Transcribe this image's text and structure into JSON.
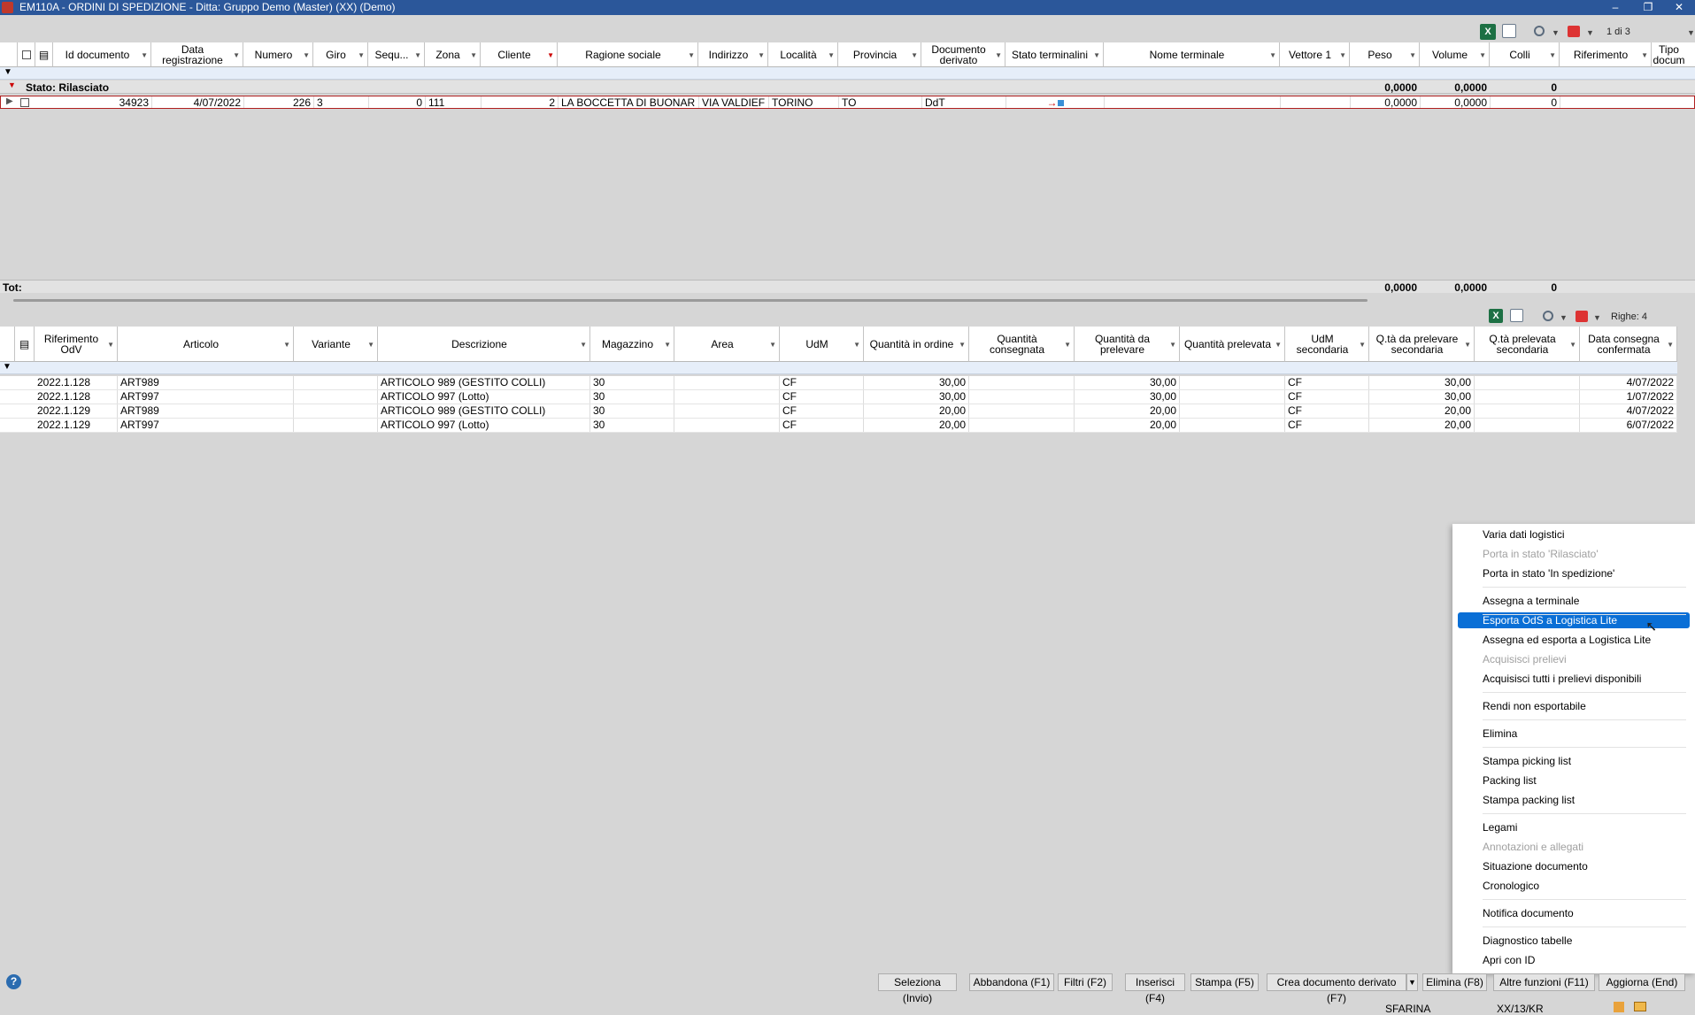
{
  "window": {
    "title": "EM110A - ORDINI DI SPEDIZIONE - Ditta: Gruppo Demo (Master) (XX)  (Demo)"
  },
  "top_toolbar": {
    "pager": "1 di 3"
  },
  "top_grid": {
    "columns": [
      "Id documento",
      "Data registrazione",
      "Numero",
      "Giro",
      "Sequ...",
      "Zona",
      "Cliente",
      "Ragione sociale",
      "Indirizzo",
      "Località",
      "Provincia",
      "Documento derivato",
      "Stato terminalini",
      "Nome terminale",
      "Vettore 1",
      "Peso",
      "Volume",
      "Colli",
      "Riferimento",
      "Tipo docum"
    ],
    "group": {
      "label": "Stato:  Rilasciato",
      "peso": "0,0000",
      "volume": "0,0000",
      "colli": "0"
    },
    "row": {
      "id": "34923",
      "data": "4/07/2022",
      "numero": "226",
      "giro": "3",
      "seq": "0",
      "zona": "111",
      "cliente": "2",
      "ragione": "LA BOCCETTA DI BUONAR",
      "indirizzo": "VIA VALDIEF",
      "localita": "TORINO",
      "provincia": "TO",
      "documento": "DdT",
      "peso": "0,0000",
      "volume": "0,0000",
      "colli": "0"
    },
    "totals": {
      "label": "Tot:",
      "peso": "0,0000",
      "volume": "0,0000",
      "colli": "0"
    }
  },
  "bottom_toolbar": {
    "righe": "Righe: 4"
  },
  "bottom_grid": {
    "columns": [
      "Riferimento OdV",
      "Articolo",
      "Variante",
      "Descrizione",
      "Magazzino",
      "Area",
      "UdM",
      "Quantità in ordine",
      "Quantità consegnata",
      "Quantità da prelevare",
      "Quantità prelevata",
      "UdM secondaria",
      "Q.tà da prelevare secondaria",
      "Q.tà prelevata secondaria",
      "Data consegna confermata"
    ],
    "rows": [
      {
        "rif": "2022.1.128",
        "art": "ART989",
        "desc": "ARTICOLO 989 (GESTITO COLLI)",
        "mag": "30",
        "udm": "CF",
        "qord": "30,00",
        "qpre": "30,00",
        "udm2": "CF",
        "qpre2": "30,00",
        "data": "4/07/2022"
      },
      {
        "rif": "2022.1.128",
        "art": "ART997",
        "desc": "ARTICOLO 997 (Lotto)",
        "mag": "30",
        "udm": "CF",
        "qord": "30,00",
        "qpre": "30,00",
        "udm2": "CF",
        "qpre2": "30,00",
        "data": "1/07/2022"
      },
      {
        "rif": "2022.1.129",
        "art": "ART989",
        "desc": "ARTICOLO 989 (GESTITO COLLI)",
        "mag": "30",
        "udm": "CF",
        "qord": "20,00",
        "qpre": "20,00",
        "udm2": "CF",
        "qpre2": "20,00",
        "data": "4/07/2022"
      },
      {
        "rif": "2022.1.129",
        "art": "ART997",
        "desc": "ARTICOLO 997 (Lotto)",
        "mag": "30",
        "udm": "CF",
        "qord": "20,00",
        "qpre": "20,00",
        "udm2": "CF",
        "qpre2": "20,00",
        "data": "6/07/2022"
      }
    ]
  },
  "context_menu": {
    "items": [
      {
        "label": "Varia dati logistici",
        "disabled": false
      },
      {
        "label": "Porta in stato 'Rilasciato'",
        "disabled": true
      },
      {
        "label": "Porta in stato 'In spedizione'",
        "disabled": false
      },
      {
        "label": "Assegna a terminale",
        "disabled": false
      },
      {
        "label": "Esporta OdS a Logistica Lite",
        "disabled": false,
        "highlighted": true
      },
      {
        "label": "Assegna ed esporta a Logistica Lite",
        "disabled": false
      },
      {
        "label": "Acquisisci prelievi",
        "disabled": true
      },
      {
        "label": "Acquisisci tutti i prelievi disponibili",
        "disabled": false
      },
      {
        "label": "Rendi non esportabile",
        "disabled": false
      },
      {
        "label": "Elimina",
        "disabled": false
      },
      {
        "label": "Stampa picking list",
        "disabled": false
      },
      {
        "label": "Packing list",
        "disabled": false
      },
      {
        "label": "Stampa packing list",
        "disabled": false
      },
      {
        "label": "Legami",
        "disabled": false
      },
      {
        "label": "Annotazioni e allegati",
        "disabled": true
      },
      {
        "label": "Situazione documento",
        "disabled": false
      },
      {
        "label": "Cronologico",
        "disabled": false
      },
      {
        "label": "Notifica documento",
        "disabled": false
      },
      {
        "label": "Diagnostico tabelle",
        "disabled": false
      },
      {
        "label": "Apri con ID",
        "disabled": false
      }
    ]
  },
  "buttons": [
    "Seleziona (Invio)",
    "Abbandona (F1)",
    "Filtri (F2)",
    "Inserisci (F4)",
    "Stampa (F5)",
    "Crea documento derivato (F7)",
    "Elimina (F8)",
    "Altre funzioni (F11)",
    "Aggiorna (End)"
  ],
  "status": {
    "user": "SFARINA",
    "code": "XX/13/KR"
  },
  "colors": {
    "titlebar": "#2b579a",
    "highlight": "#0a6fd6",
    "filter_row": "#e6eef9"
  }
}
